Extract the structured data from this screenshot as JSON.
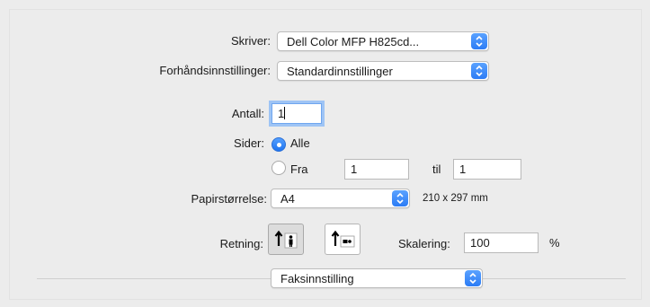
{
  "printer": {
    "label": "Skriver:",
    "value": "Dell Color MFP H825cd..."
  },
  "presets": {
    "label": "Forhåndsinnstillinger:",
    "value": "Standardinnstillinger"
  },
  "copies": {
    "label": "Antall:",
    "value": "1"
  },
  "pages": {
    "label": "Sider:",
    "all_label": "Alle",
    "from_label": "Fra",
    "from_value": "1",
    "to_label": "til",
    "to_value": "1"
  },
  "paper_size": {
    "label": "Papirstørrelse:",
    "value": "A4",
    "dimensions": "210 x 297 mm"
  },
  "orientation": {
    "label": "Retning:"
  },
  "scale": {
    "label": "Skalering:",
    "value": "100",
    "unit": "%"
  },
  "section": {
    "value": "Faksinnstilling"
  },
  "colors": {
    "accent": "#2c7cf5",
    "focus_ring": "#9ec4f5"
  }
}
